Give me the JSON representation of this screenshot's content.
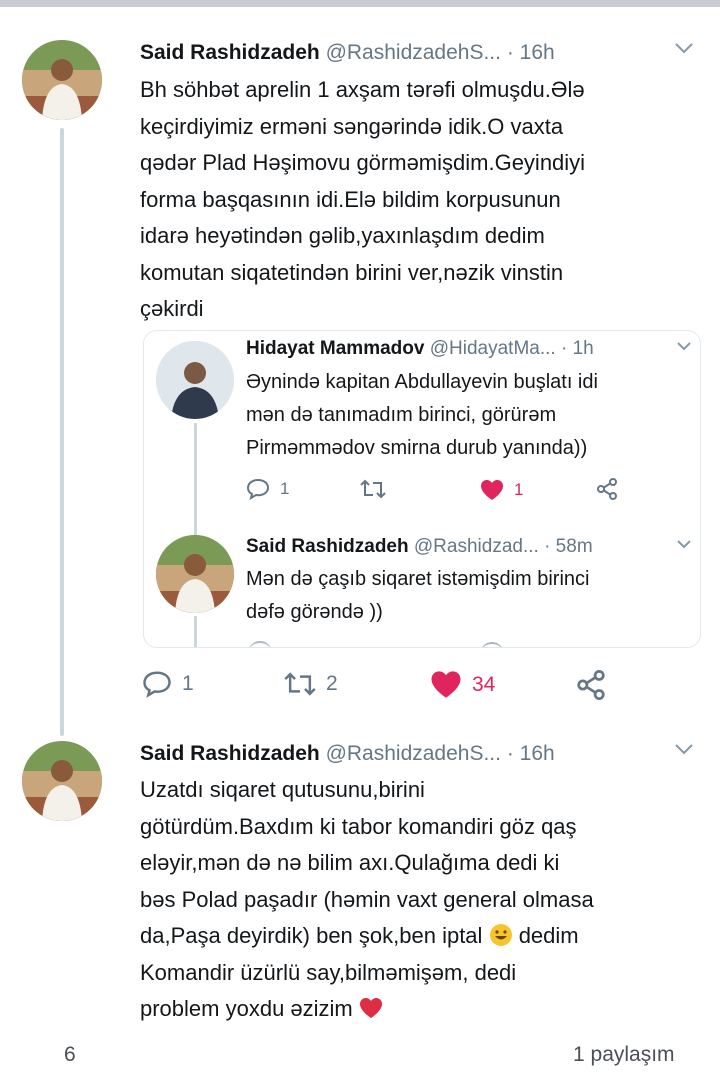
{
  "tweet1": {
    "name": "Said Rashidzadeh",
    "handle": "@RashidzadehS...",
    "time": "· 16h",
    "text": "Bh söhbət aprelin 1 axşam tərəfi olmuşdu.Ələ\nkeçirdiyimiz erməni səngərində idik.O vaxta\nqədər Plad Həşimovu görməmişdim.Geyindiyi\nforma başqasının idi.Elə bildim korpusunun\nidarə heyətindən gəlib,yaxınlaşdım dedim\nkomutan siqatetindən birini ver,nəzik vinstin\nçəkirdi",
    "reply_count": "1",
    "retweet_count": "2",
    "like_count": "34"
  },
  "quote": {
    "reply1": {
      "name": "Hidayat Mammadov",
      "handle": "@HidayatMa...",
      "time": "· 1h",
      "text": "Əynində kapitan Abdullayevin buşlatı idi\nmən də tanımadım birinci, görürəm\nPirməmmədov smirna durub yanında))",
      "reply_count": "1",
      "like_count": "1"
    },
    "reply2": {
      "name": "Said Rashidzadeh",
      "handle": "@Rashidzad...",
      "time": "· 58m",
      "text": "Mən də çaşıb siqaret istəmişdim birinci\ndəfə görəndə ))"
    }
  },
  "tweet2": {
    "name": "Said Rashidzadeh",
    "handle": "@RashidzadehS...",
    "time": "· 16h",
    "text_before_emoji": "Uzatdı siqaret qutusunu,birini\ngötürdüm.Baxdım ki tabor komandiri göz qaş\neləyir,mən də nə bilim axı.Qulağıma dedi ki\nbəs Polad paşadır (həmin vaxt general olmasa\nda,Paşa deyirdik)  ben şok,ben iptal",
    "text_after_emoji": "dedim\nKomandir üzürlü say,bilməmişəm, dedi\nproblem yoxdu əzizim"
  },
  "footer": {
    "reactions": "6",
    "shares": "1 paylaşım"
  },
  "colors": {
    "like": "#e0245e",
    "muted": "#657786",
    "thread": "#ccd6dd"
  },
  "icons": [
    "chevron-down-icon",
    "reply-icon",
    "retweet-icon",
    "heart-icon",
    "share-icon",
    "grinning-emoji",
    "red-heart-emoji"
  ]
}
